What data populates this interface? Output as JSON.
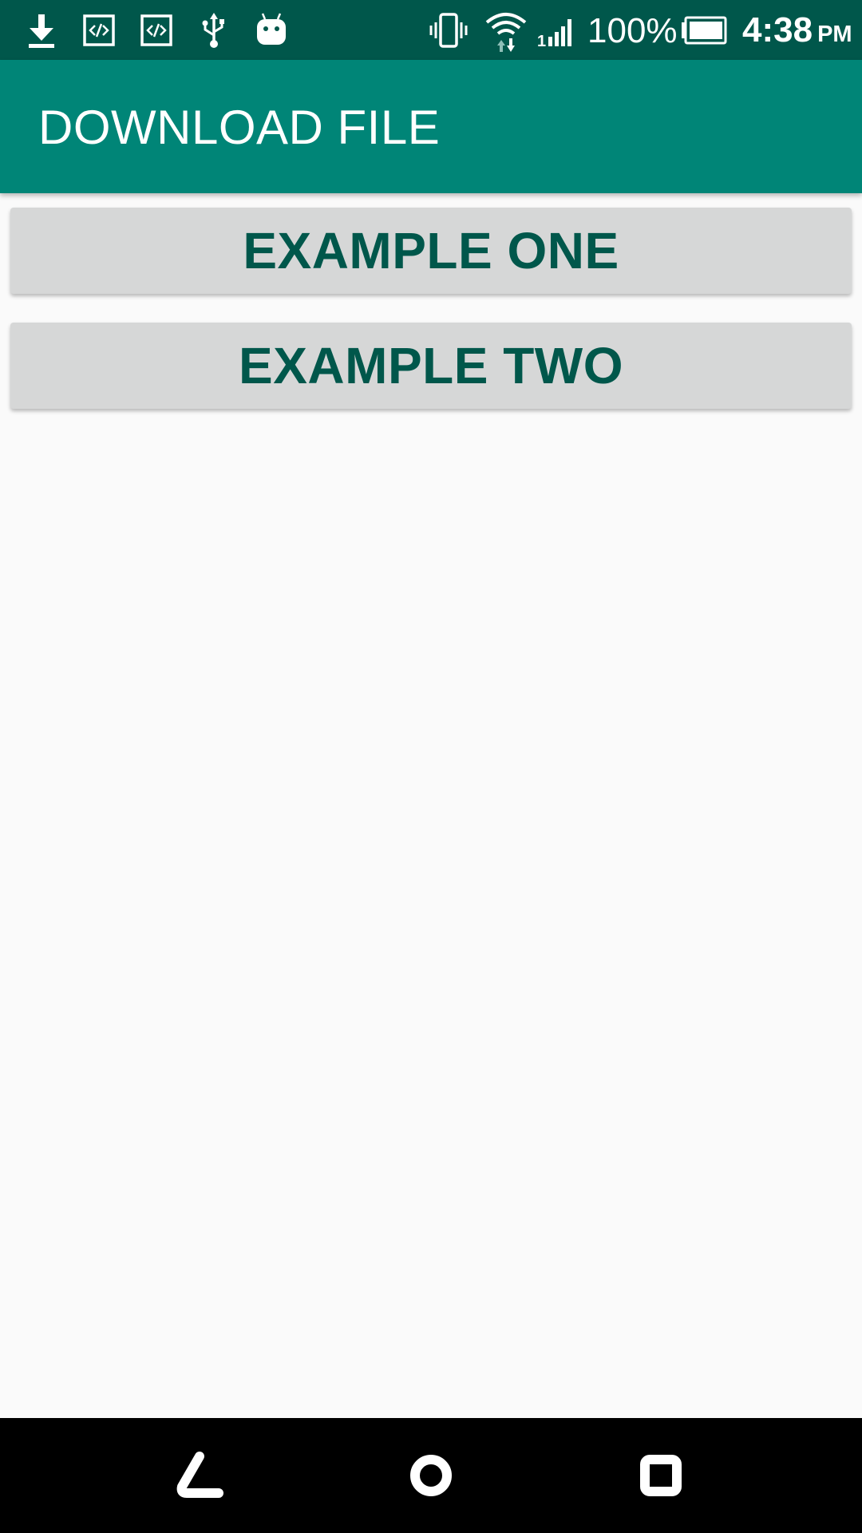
{
  "status_bar": {
    "icons_left": [
      "download-icon",
      "code-notification-icon",
      "code-notification-icon",
      "usb-icon",
      "android-icon"
    ],
    "icons_right": [
      "vibrate-icon",
      "wifi-icon",
      "signal-icon",
      "battery-icon"
    ],
    "signal_label": "1",
    "battery_percent": "100%",
    "clock_time": "4:38",
    "clock_ampm": "PM",
    "background_color": "#00574b"
  },
  "app_bar": {
    "title": "DOWNLOAD FILE",
    "background_color": "#008577"
  },
  "main": {
    "buttons": [
      {
        "label": "EXAMPLE ONE"
      },
      {
        "label": "EXAMPLE TWO"
      }
    ],
    "button_text_color": "#00574b",
    "button_background": "#d6d7d7"
  },
  "nav_bar": {
    "buttons": [
      "back-icon",
      "home-icon",
      "recents-icon"
    ]
  }
}
